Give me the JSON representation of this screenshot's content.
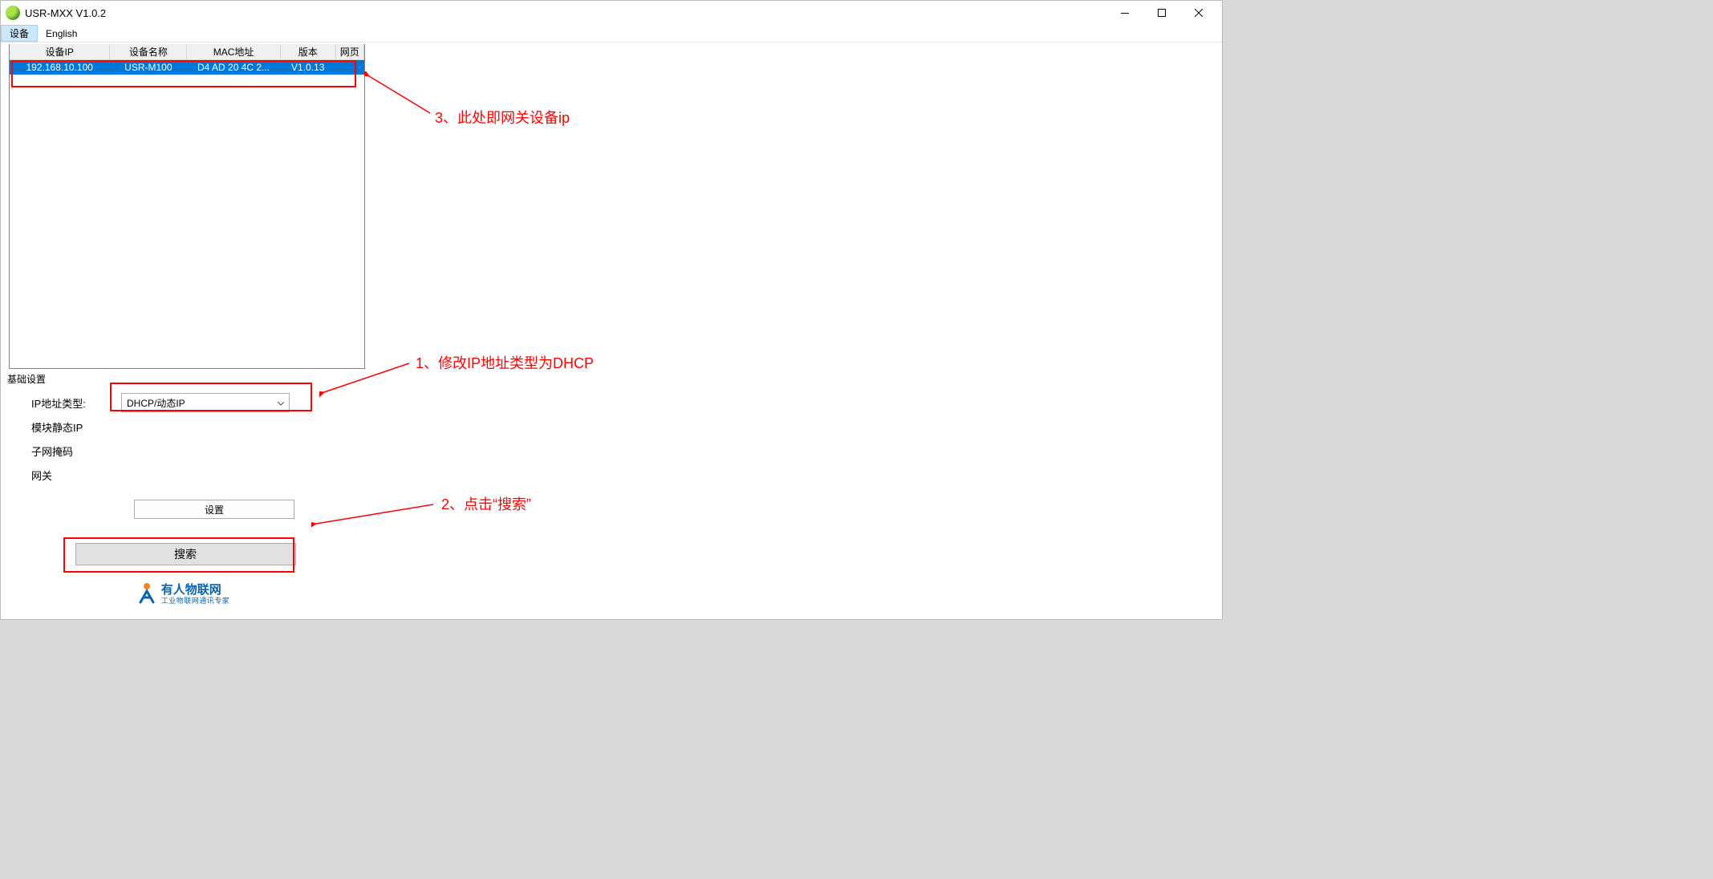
{
  "title": "USR-MXX  V1.0.2",
  "menu": {
    "device": "设备",
    "english": "English"
  },
  "table": {
    "headers": {
      "ip": "设备IP",
      "name": "设备名称",
      "mac": "MAC地址",
      "ver": "版本",
      "web": "网页"
    },
    "row": {
      "ip": "192.168.10.100",
      "name": "USR-M100",
      "mac": "D4 AD 20 4C 2...",
      "ver": "V1.0.13",
      "web": ""
    }
  },
  "basic": {
    "title": "基础设置",
    "ip_type_label": "IP地址类型:",
    "ip_type_value": "DHCP/动态IP",
    "static_ip_label": "模块静态IP",
    "subnet_label": "子网掩码",
    "gateway_label": "网关",
    "set_btn": "设置",
    "search_btn": "搜索"
  },
  "logo": {
    "main": "有人物联网",
    "sub": "工业物联网通讯专家"
  },
  "annotations": {
    "a3": "3、此处即网关设备ip",
    "a1": "1、修改IP地址类型为DHCP",
    "a2": "2、点击“搜索”"
  }
}
